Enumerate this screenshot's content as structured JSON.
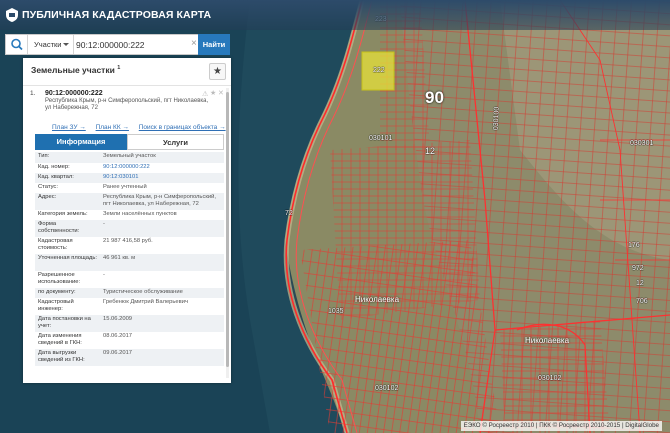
{
  "header": {
    "title": "ПУБЛИЧНАЯ КАДАСТРОВАЯ КАРТА"
  },
  "search": {
    "type_label": "Участки",
    "query": "90:12:000000:222",
    "find_label": "Найти"
  },
  "panel": {
    "title": "Земельные участки",
    "count": "1",
    "result": {
      "index": "1.",
      "cad_number": "90:12:000000:222",
      "address": "Республика Крым, р-н Симферопольский, пгт Николаевка, ул Набережная, 72",
      "links": [
        "План ЗУ →",
        "План КК →",
        "Поиск в границах объекта →"
      ]
    },
    "tabs": [
      "Информация",
      "Услуги"
    ],
    "rows": [
      {
        "k": "Тип:",
        "v": "Земельный участок",
        "link": false
      },
      {
        "k": "Кад. номер:",
        "v": "90:12:000000:222",
        "link": true
      },
      {
        "k": "Кад. квартал:",
        "v": "90:12:030101",
        "link": true
      },
      {
        "k": "Статус:",
        "v": "Ранее учтенный",
        "link": false
      },
      {
        "k": "Адрес:",
        "v": "Республика Крым, р-н Симферопольский, пгт Николаевка, ул Набережная, 72",
        "link": false
      },
      {
        "k": "Категория земель:",
        "v": "Земли населённых пунктов",
        "link": false
      },
      {
        "k": "Форма собственности:",
        "v": "-",
        "link": false
      },
      {
        "k": "Кадастровая стоимость:",
        "v": "21 987 416,58 руб.",
        "link": false
      },
      {
        "k": "Уточненная площадь:",
        "v": "46 961 кв. м",
        "link": false
      },
      {
        "k": "Разрешенное использование:",
        "v": "-",
        "link": false
      },
      {
        "k": "по документу:",
        "v": "Туристическое обслуживание",
        "link": false
      },
      {
        "k": "Кадастровый инженер:",
        "v": "Гребенюк Дмитрий Валерьевич",
        "link": false
      },
      {
        "k": "Дата постановки на учет:",
        "v": "15.06.2009",
        "link": false
      },
      {
        "k": "Дата изменения сведений в ГКН:",
        "v": "08.06.2017",
        "link": false
      },
      {
        "k": "Дата выгрузки сведений из ГКН:",
        "v": "09.06.2017",
        "link": false
      }
    ]
  },
  "map": {
    "labels": {
      "q90": "90",
      "n12": "12",
      "n222": "222",
      "n223": "223",
      "n030101": "030101",
      "n030100": "030100",
      "n030301": "030301",
      "n030102": "030102",
      "n030102b": "030102",
      "n176": "176",
      "n972": "972",
      "n12b": "12",
      "n706": "706",
      "n72": "72",
      "n1035": "1035",
      "town1": "Николаевка",
      "town2": "Николаевка"
    },
    "attribution": "ЕЭКО © Росреестр 2010 | ПКК © Росреестр 2010-2015 | DigitalGlobe"
  },
  "colors": {
    "accent": "#1f70b0",
    "parcel_line": "#e02020",
    "selected_parcel": "#e8e23a"
  }
}
